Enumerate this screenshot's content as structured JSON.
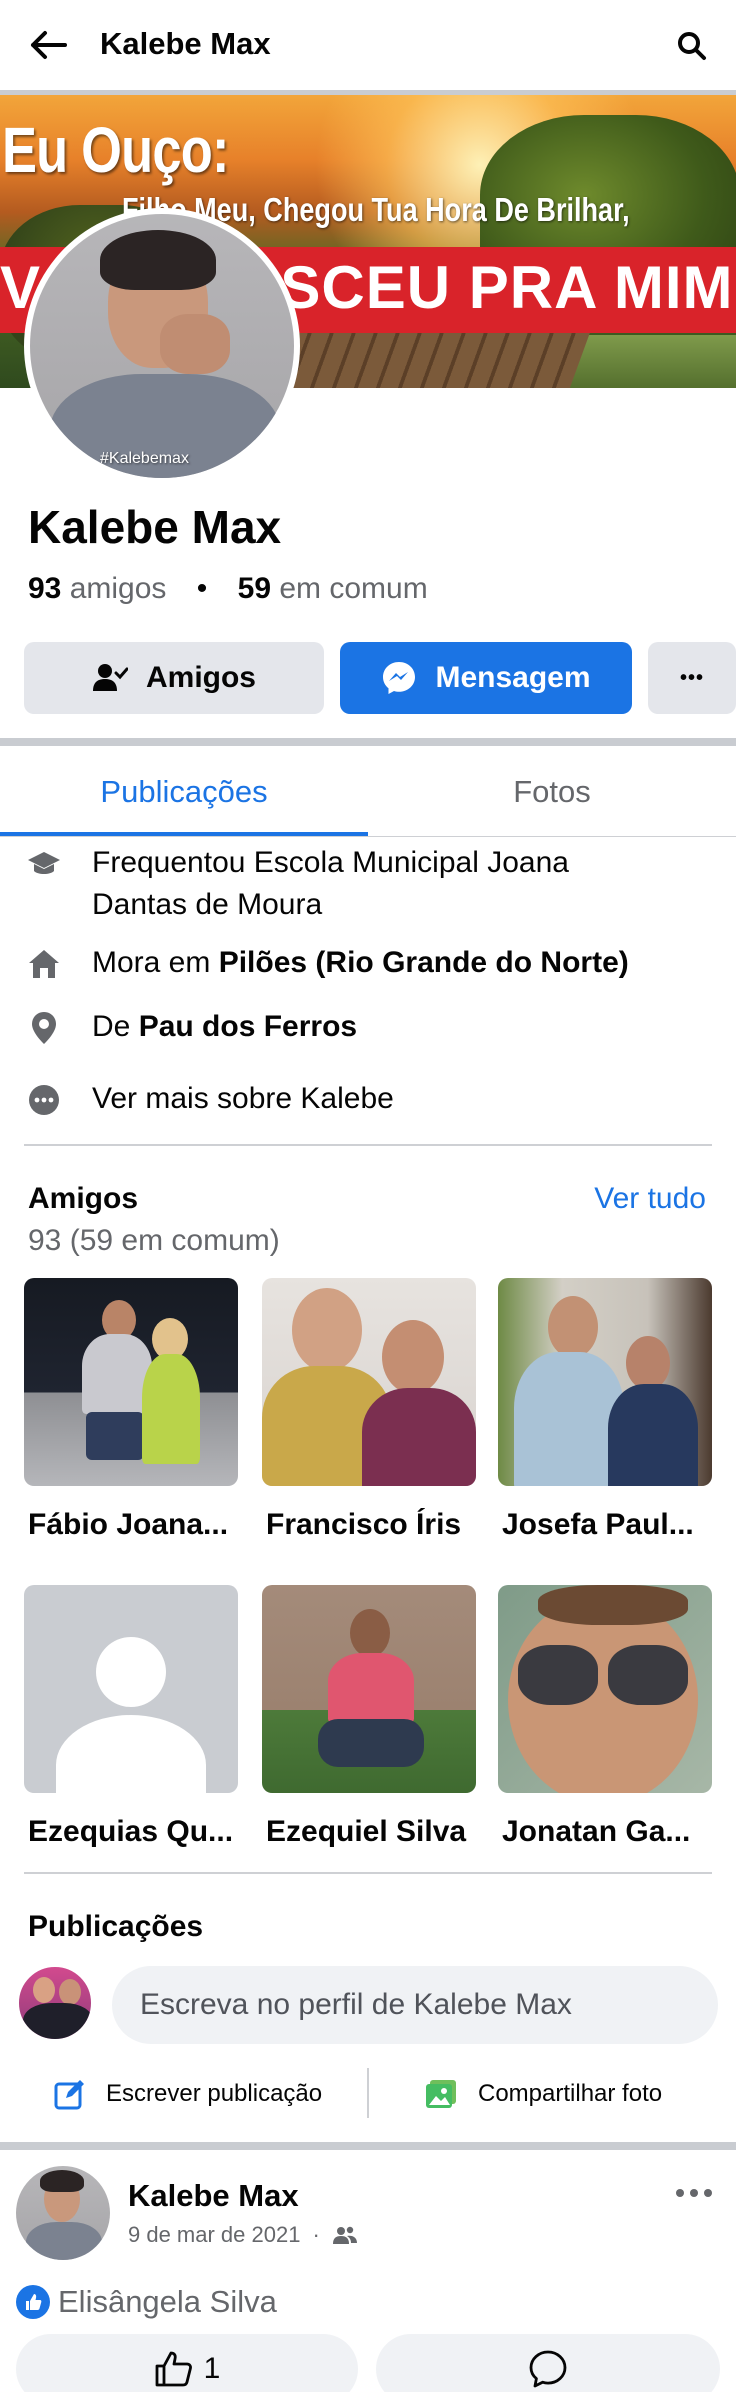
{
  "header": {
    "title": "Kalebe Max",
    "back_icon": "arrow-left-icon",
    "search_icon": "search-icon"
  },
  "cover": {
    "line1": "Eu Ouço:",
    "line2": "Filho Meu, Chegou Tua Hora De Brilhar,",
    "line3": "VOCÊ NASCEU PRA MIM.",
    "banner_color": "#d9232a"
  },
  "avatar": {
    "tag": "#Kalebemax"
  },
  "profile": {
    "name": "Kalebe Max",
    "friends_count": "93",
    "friends_label": "amigos",
    "mutual_count": "59",
    "mutual_label": "em comum",
    "separator": "•"
  },
  "actions": {
    "friends_label": "Amigos",
    "message_label": "Mensagem",
    "more_label": "•••"
  },
  "tabs": [
    {
      "label": "Publicações",
      "active": true
    },
    {
      "label": "Fotos",
      "active": false
    }
  ],
  "about": {
    "education": "Frequentou Escola Municipal Joana Dantas de Moura",
    "lives_prefix": "Mora em",
    "lives_place": "Pilões (Rio Grande do Norte)",
    "from_prefix": "De",
    "from_place": "Pau dos Ferros",
    "see_more": "Ver mais sobre Kalebe"
  },
  "friends": {
    "title": "Amigos",
    "see_all": "Ver tudo",
    "count": "93 (59 em comum)",
    "list": [
      {
        "name": "Fábio Joana..."
      },
      {
        "name": "Francisco Íris"
      },
      {
        "name": "Josefa Paul..."
      },
      {
        "name": "Ezequias Qu..."
      },
      {
        "name": "Ezequiel Silva"
      },
      {
        "name": "Jonatan Ga..."
      }
    ]
  },
  "composer": {
    "title": "Publicações",
    "placeholder": "Escreva no perfil de Kalebe Max",
    "write_label": "Escrever publicação",
    "photo_label": "Compartilhar foto"
  },
  "post": {
    "author": "Kalebe Max",
    "date": "9 de mar de 2021",
    "meta_separator": "·",
    "reactor": "Elisângela Silva",
    "like_count": "1"
  },
  "colors": {
    "accent": "#1b74e4",
    "secondary_text": "#65676b",
    "button_gray": "#e4e6eb"
  }
}
